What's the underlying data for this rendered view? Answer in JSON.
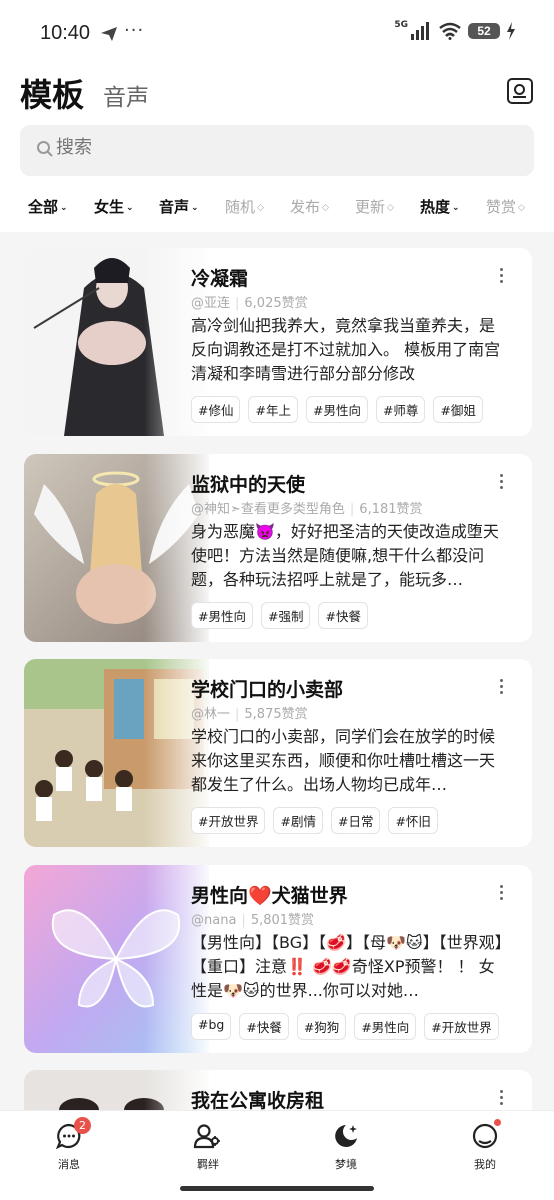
{
  "status_bar": {
    "time": "10:40",
    "dots": "···",
    "network": "5G",
    "battery": "52"
  },
  "header": {
    "title": "模板",
    "subtitle": "音声"
  },
  "search": {
    "placeholder": "搜索"
  },
  "filters": [
    {
      "label": "全部",
      "style": "dark"
    },
    {
      "label": "女生",
      "style": "dark"
    },
    {
      "label": "音声",
      "style": "dark"
    },
    {
      "label": "随机",
      "style": "light"
    },
    {
      "label": "发布",
      "style": "light"
    },
    {
      "label": "更新",
      "style": "light"
    },
    {
      "label": "热度",
      "style": "dark"
    },
    {
      "label": "赞赏",
      "style": "light"
    }
  ],
  "cards": [
    {
      "title": "冷凝霜",
      "author": "@亚连",
      "likes": "6,025赞赏",
      "desc": "高冷剑仙把我养大，竟然拿我当童养夫，是反向调教还是打不过就加入。 模板用了南宫清凝和李晴雪进行部分部分修改",
      "tags": [
        "#修仙",
        "#年上",
        "#男性向",
        "#师尊",
        "#御姐"
      ]
    },
    {
      "title": "监狱中的天使",
      "author": "@神知➣查看更多类型角色",
      "likes": "6,181赞赏",
      "desc": "身为恶魔👿，好好把圣洁的天使改造成堕天使吧！方法当然是随便嘛,想干什么都没问题，各种玩法招呼上就是了，能玩多…",
      "tags": [
        "#男性向",
        "#强制",
        "#快餐"
      ]
    },
    {
      "title": "学校门口的小卖部",
      "author": "@林一",
      "likes": "5,875赞赏",
      "desc": "学校门口的小卖部，同学们会在放学的时候来你这里买东西，顺便和你吐槽吐槽这一天都发生了什么。出场人物均已成年…",
      "tags": [
        "#开放世界",
        "#剧情",
        "#日常",
        "#怀旧"
      ]
    },
    {
      "title": "男性向❤️犬猫世界",
      "author": "@nana",
      "likes": "5,801赞赏",
      "desc": "【男性向】【BG】【🥩】【母🐶🐱】【世界观】【重口】注意‼️ 🥩🥩奇怪XP预警！ ！ 女性是🐶🐱的世界...你可以对她…",
      "tags": [
        "#bg",
        "#快餐",
        "#狗狗",
        "#男性向",
        "#开放世界"
      ]
    },
    {
      "title": "我在公寓收房租",
      "author": "",
      "likes": "",
      "desc": "",
      "tags": []
    }
  ],
  "bottom_nav": [
    {
      "label": "消息",
      "icon": "chat-bubble-icon",
      "badge": "2"
    },
    {
      "label": "羁绊",
      "icon": "users-icon"
    },
    {
      "label": "梦境",
      "icon": "moon-sparkle-icon"
    },
    {
      "label": "我的",
      "icon": "profile-circle-icon"
    }
  ],
  "colors": {
    "badge": "#e8524a",
    "card_bg": "#ffffff",
    "page_bg": "#f5f5f5"
  }
}
